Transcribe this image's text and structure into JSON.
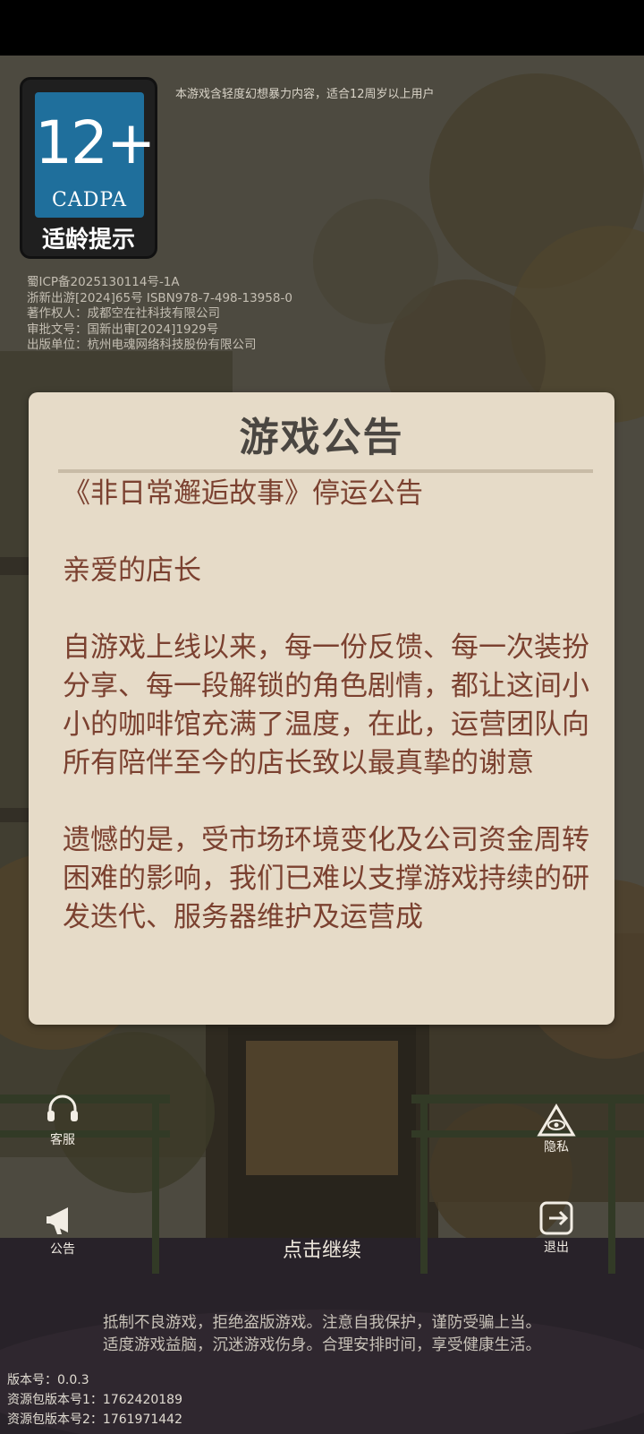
{
  "age_rating": {
    "number": "12+",
    "organization": "CADPA",
    "label": "适龄提示",
    "notice": "本游戏含轻度幻想暴力内容，适合12周岁以上用户"
  },
  "legal_info": [
    "蜀ICP备2025130114号-1A",
    "浙新出游[2024]65号 ISBN978-7-498-13958-0",
    "著作权人：成都空在社科技有限公司",
    "审批文号：国新出审[2024]1929号",
    "出版单位：杭州电魂网络科技股份有限公司"
  ],
  "announcement": {
    "title": "游戏公告",
    "heading": "《非日常邂逅故事》停运公告",
    "greeting": "亲爱的店长",
    "paragraph1": "自游戏上线以来，每一份反馈、每一次装扮分享、每一段解锁的角色剧情，都让这间小小的咖啡馆充满了温度，在此，运营团队向所有陪伴至今的店长致以最真挚的谢意",
    "paragraph2": "遗憾的是，受市场环境变化及公司资金周转困难的影响，我们已难以支撑游戏持续的研发迭代、服务器维护及运营成"
  },
  "side_buttons": {
    "customer_service": "客服",
    "announcement": "公告",
    "privacy": "隐私",
    "exit": "退出"
  },
  "continue_prompt": "点击继续",
  "health_notice": [
    "抵制不良游戏，拒绝盗版游戏。注意自我保护，谨防受骗上当。",
    "适度游戏益脑，沉迷游戏伤身。合理安排时间，享受健康生活。"
  ],
  "version_info": [
    "版本号：0.0.3",
    "资源包版本号1：1762420189",
    "资源包版本号2：1761971442"
  ],
  "colors": {
    "dialog_bg": "#e6dbc8",
    "dialog_title": "#4a4641",
    "dialog_text": "#7b4130",
    "badge_blue": "#1f6f9c"
  }
}
